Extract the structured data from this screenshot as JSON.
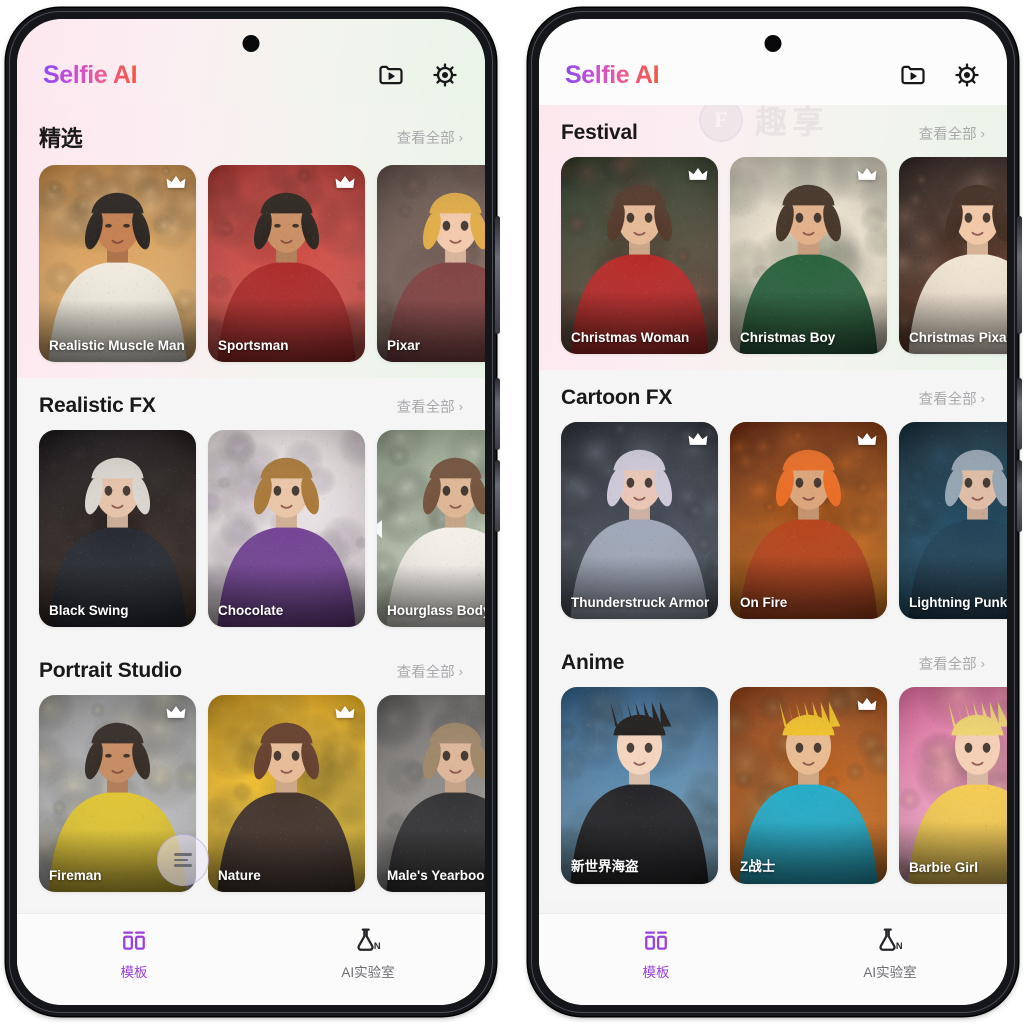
{
  "app": {
    "brand": "Selfie AI",
    "header_icons": [
      {
        "name": "video-folder-icon",
        "label": "My Creations"
      },
      {
        "name": "gear-icon",
        "label": "Settings"
      }
    ],
    "see_all_label": "查看全部",
    "chevron": "›",
    "watermark": {
      "logo_letter": "F",
      "text": "趣享"
    }
  },
  "theme": {
    "brand_gradient_start": "#8a4bf0",
    "brand_gradient_end": "#f5553f",
    "accent": "#9b3fe0",
    "header_tint_left": "#fde7ee",
    "header_tint_right": "#e9f4e8",
    "page_bg": "#f5f5f5",
    "tabbar_bg": "#fbfbfb",
    "muted_text": "#a9a9ad"
  },
  "tabbar": {
    "items": [
      {
        "label": "模板",
        "icon": "template-grid-icon",
        "active": true
      },
      {
        "label": "AI实验室",
        "icon": "flask-ai-icon",
        "active": false
      }
    ]
  },
  "phones": [
    {
      "id": "phone-left",
      "sections": [
        {
          "title": "精选",
          "title_cjk": true,
          "tinted": true,
          "watermark": false,
          "cards": [
            {
              "name": "Realistic Muscle Man",
              "premium": true,
              "art": "muscleman"
            },
            {
              "name": "Sportsman",
              "premium": true,
              "art": "sportsman"
            },
            {
              "name": "Pixar",
              "premium": false,
              "art": "pixar"
            }
          ]
        },
        {
          "title": "Realistic FX",
          "title_cjk": false,
          "tinted": false,
          "watermark": false,
          "prev_arrow_on_card": 2,
          "cards": [
            {
              "name": "Black Swing",
              "premium": false,
              "art": "blackswing"
            },
            {
              "name": "Chocolate",
              "premium": false,
              "art": "chocolate"
            },
            {
              "name": "Hourglass Body",
              "premium": false,
              "art": "hourglass"
            }
          ]
        },
        {
          "title": "Portrait Studio",
          "title_cjk": false,
          "tinted": false,
          "watermark": false,
          "fab_on_rail": true,
          "cards": [
            {
              "name": "Fireman",
              "premium": true,
              "art": "fireman"
            },
            {
              "name": "Nature",
              "premium": true,
              "art": "nature"
            },
            {
              "name": "Male's Yearbook",
              "premium": false,
              "art": "yearbook"
            }
          ]
        }
      ]
    },
    {
      "id": "phone-right",
      "sections": [
        {
          "title": "Festival",
          "title_cjk": false,
          "tinted": true,
          "watermark": true,
          "cards": [
            {
              "name": "Christmas Woman",
              "premium": true,
              "art": "xmaswoman"
            },
            {
              "name": "Christmas Boy",
              "premium": true,
              "art": "xmasboy"
            },
            {
              "name": "Christmas Pixar",
              "premium": false,
              "art": "xmaspixar"
            }
          ]
        },
        {
          "title": "Cartoon FX",
          "title_cjk": false,
          "tinted": false,
          "watermark": false,
          "cards": [
            {
              "name": "Thunderstruck Armor",
              "premium": true,
              "art": "thunder"
            },
            {
              "name": "On Fire",
              "premium": true,
              "art": "onfire"
            },
            {
              "name": "Lightning Punk",
              "premium": false,
              "art": "lightning"
            }
          ]
        },
        {
          "title": "Anime",
          "title_cjk": false,
          "tinted": false,
          "watermark": false,
          "cards": [
            {
              "name": "新世界海盗",
              "premium": false,
              "art": "pirate"
            },
            {
              "name": "Z战士",
              "premium": true,
              "art": "zfighter"
            },
            {
              "name": "Barbie Girl",
              "premium": false,
              "art": "barbie"
            }
          ]
        }
      ]
    }
  ]
}
